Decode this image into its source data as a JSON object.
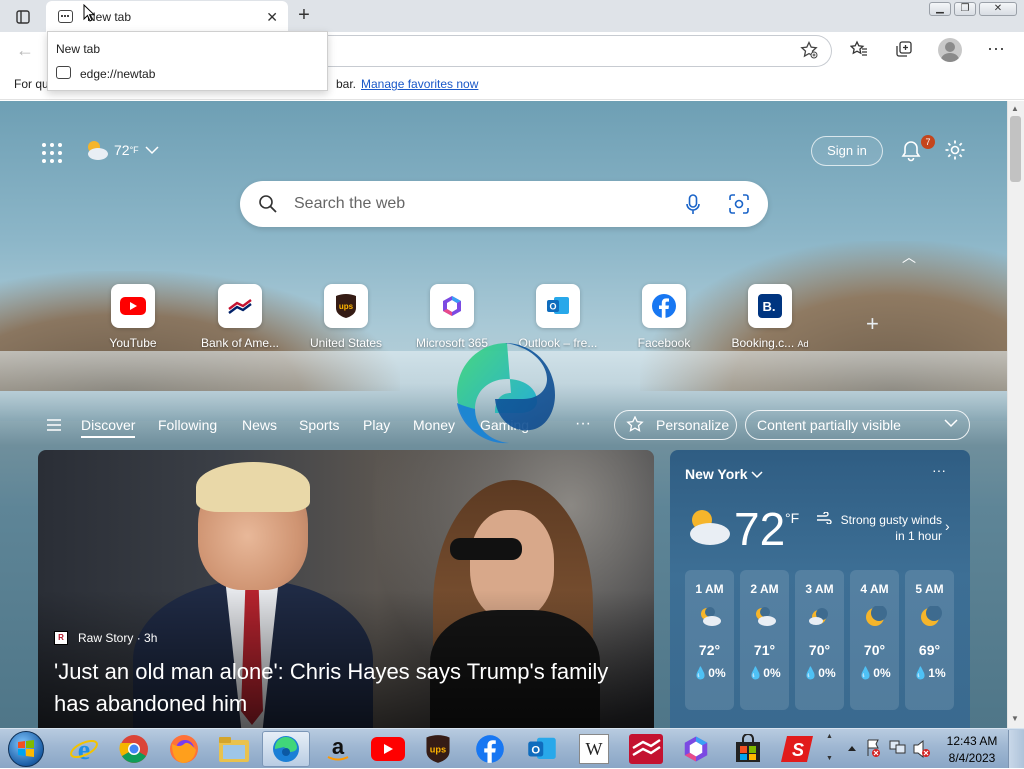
{
  "browser": {
    "tab": {
      "title": "New tab"
    },
    "tab_popup": {
      "title": "New tab",
      "url": "edge://newtab"
    },
    "favorites_bar": {
      "message_start": "For qu",
      "message_end": "bar.",
      "link": "Manage favorites now"
    }
  },
  "page": {
    "weather_chip": {
      "temp": "72",
      "unit": "°F"
    },
    "signin_label": "Sign in",
    "notification_count": "7",
    "search": {
      "placeholder": "Search the web"
    },
    "quick_links": [
      {
        "label": "YouTube",
        "icon": "youtube-icon",
        "color": "#ff0000"
      },
      {
        "label": "Bank of Ame...",
        "icon": "bank-of-america-icon",
        "color": "#c41230"
      },
      {
        "label": "United States",
        "icon": "ups-icon",
        "color": "#351c15"
      },
      {
        "label": "Microsoft 365",
        "icon": "microsoft-365-icon",
        "color": "#7b4ae2"
      },
      {
        "label": "Outlook – fre...",
        "icon": "outlook-icon",
        "color": "#0f6cbd"
      },
      {
        "label": "Facebook",
        "icon": "facebook-icon",
        "color": "#1877f2"
      },
      {
        "label": "Booking.c...",
        "icon": "booking-icon",
        "color": "#003580",
        "ad": "Ad"
      }
    ],
    "feed_tabs": [
      "Discover",
      "Following",
      "News",
      "Sports",
      "Play",
      "Money",
      "Gaming"
    ],
    "feed_more": "···",
    "personalize_label": "Personalize",
    "content_visibility": "Content partially visible",
    "news_card": {
      "source": "Raw Story",
      "age": "3h",
      "headline": "'Just an old man alone': Chris Hayes says Trump's family has abandoned him"
    },
    "weather_card": {
      "city": "New York",
      "temp": "72",
      "unit": "°F",
      "alert": "Strong gusty winds in 1 hour",
      "hourly": [
        {
          "time": "1 AM",
          "temp": "72°",
          "precip": "0%",
          "icon": "partly-cloudy-night-icon"
        },
        {
          "time": "2 AM",
          "temp": "71°",
          "precip": "0%",
          "icon": "partly-cloudy-night-icon"
        },
        {
          "time": "3 AM",
          "temp": "70°",
          "precip": "0%",
          "icon": "partly-cloudy-night-icon"
        },
        {
          "time": "4 AM",
          "temp": "70°",
          "precip": "0%",
          "icon": "moon-icon"
        },
        {
          "time": "5 AM",
          "temp": "69°",
          "precip": "1%",
          "icon": "moon-icon"
        }
      ]
    }
  },
  "taskbar": {
    "apps": [
      "internet-explorer",
      "chrome",
      "firefox",
      "file-explorer",
      "edge",
      "amazon",
      "youtube",
      "ups",
      "facebook",
      "outlook",
      "wikipedia",
      "bank-of-america",
      "microsoft-365",
      "microsoft-store",
      "speedway"
    ],
    "wikipedia_letter": "W",
    "time": "12:43 AM",
    "date": "8/4/2023"
  }
}
